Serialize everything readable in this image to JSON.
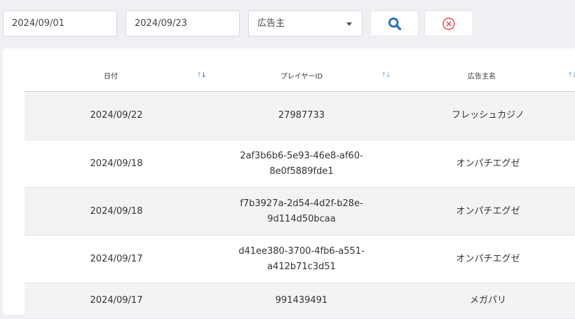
{
  "filters": {
    "start_date": "2024/09/01",
    "end_date": "2024/09/23",
    "advertiser_selected": "広告主"
  },
  "colors": {
    "accent": "#1f6fbf",
    "clear_icon": "#e0464f",
    "sort_inactive": "#7fb3d5"
  },
  "table": {
    "headers": {
      "date": "日付",
      "player_id": "プレイヤーID",
      "advertiser_name": "広告主名"
    },
    "sort_glyph_up": "↑",
    "sort_glyph_down": "↓",
    "rows": [
      {
        "date": "2024/09/22",
        "player_id_1": "27987733",
        "player_id_2": "",
        "advertiser": "フレッシュカジノ"
      },
      {
        "date": "2024/09/18",
        "player_id_1": "2af3b6b6-5e93-46e8-af60-",
        "player_id_2": "8e0f5889fde1",
        "advertiser": "オンパチエグゼ"
      },
      {
        "date": "2024/09/18",
        "player_id_1": "f7b3927a-2d54-4d2f-b28e-",
        "player_id_2": "9d114d50bcaa",
        "advertiser": "オンパチエグゼ"
      },
      {
        "date": "2024/09/17",
        "player_id_1": "d41ee380-3700-4fb6-a551-",
        "player_id_2": "a412b71c3d51",
        "advertiser": "オンパチエグゼ"
      },
      {
        "date": "2024/09/17",
        "player_id_1": "991439491",
        "player_id_2": "",
        "advertiser": "メガパリ"
      }
    ]
  }
}
